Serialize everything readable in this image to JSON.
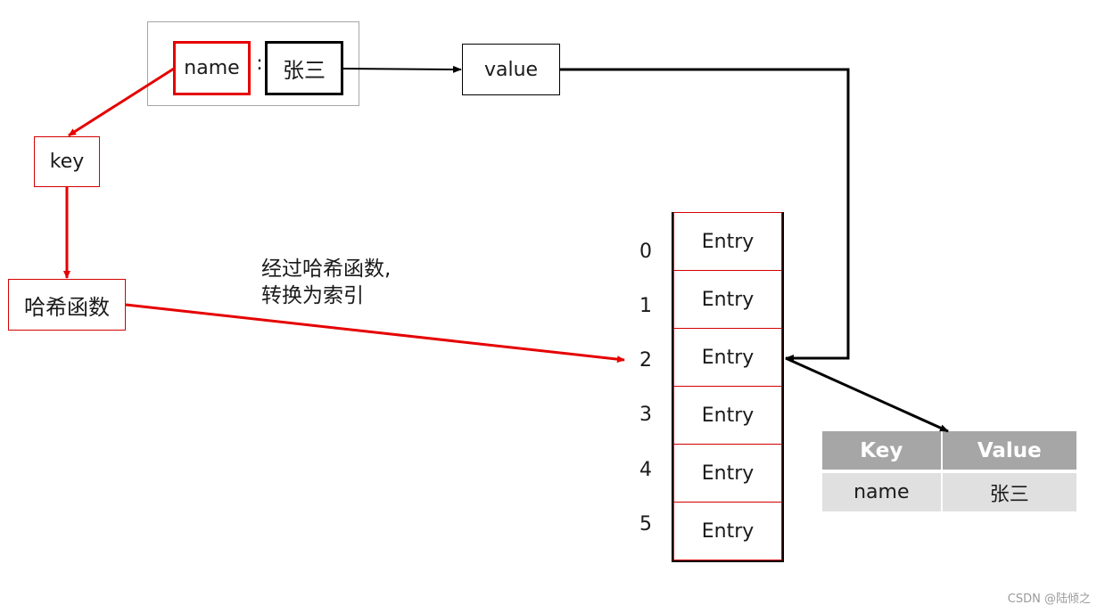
{
  "pair": {
    "key_text": "name",
    "separator": ":",
    "value_text": "张三"
  },
  "labels": {
    "value": "value",
    "key": "key",
    "hash_function": "哈希函数",
    "note": "经过哈希函数,\n转换为索引"
  },
  "array": {
    "indices": [
      "0",
      "1",
      "2",
      "3",
      "4",
      "5"
    ],
    "cells": [
      "Entry",
      "Entry",
      "Entry",
      "Entry",
      "Entry",
      "Entry"
    ],
    "target_index": 2
  },
  "entry_table": {
    "headers": [
      "Key",
      "Value"
    ],
    "row": [
      "name",
      "张三"
    ]
  },
  "colors": {
    "red": "#e60000",
    "black": "#000000",
    "header_gray": "#a6a6a6",
    "row_gray": "#e0e0e0"
  },
  "watermark": "CSDN @陆倾之"
}
